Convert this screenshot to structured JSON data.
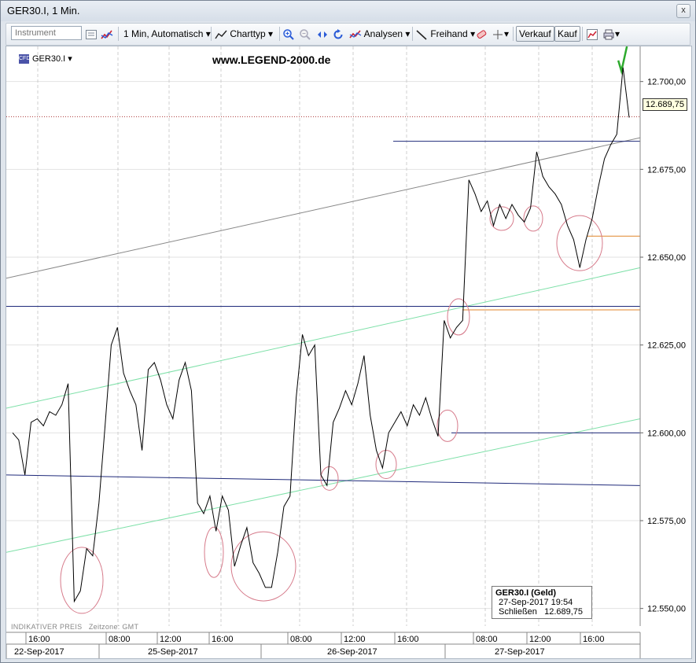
{
  "window": {
    "title": "GER30.I, 1 Min.",
    "close_label": "x"
  },
  "toolbar": {
    "instrument_placeholder": "Instrument",
    "interval_label": "1 Min,  Automatisch",
    "charttyp_label": "Charttyp",
    "analysen_label": "Analysen",
    "freihand_label": "Freihand",
    "verkauf_label": "Verkauf",
    "kauf_label": "Kauf"
  },
  "chart": {
    "symbol": "GER30.I",
    "watermark": "www.LEGEND-2000.de",
    "last_price_tag": "12.689,75",
    "footer_left": "INDIKATIVER PREIS",
    "timezone": "Zeitzone: GMT",
    "info": {
      "title": "GER30.I (Geld)",
      "datetime": "27-Sep-2017 19:54",
      "close_label": "Schließen",
      "close_value": "12.689,75"
    },
    "colors": {
      "price_line": "#000000",
      "channel": "#7ee0a8",
      "level": "#1f2a7a",
      "trend": "#888888",
      "orange": "#e0852a",
      "circle": "#d67a8a"
    }
  },
  "chart_data": {
    "type": "line",
    "ylim": [
      12545,
      12710
    ],
    "y_ticks": [
      "12.700,00",
      "12.675,00",
      "12.650,00",
      "12.625,00",
      "12.600,00",
      "12.575,00",
      "12.550,00"
    ],
    "time_ticks": [
      "16:00",
      "08:00",
      "12:00",
      "16:00",
      "08:00",
      "12:00",
      "16:00",
      "08:00",
      "12:00",
      "16:00"
    ],
    "dates": [
      "22-Sep-2017",
      "25-Sep-2017",
      "26-Sep-2017",
      "27-Sep-2017"
    ],
    "series": [
      {
        "values": [
          12600,
          12598,
          12588,
          12603,
          12604,
          12602,
          12606,
          12605,
          12608,
          12614,
          12552,
          12555,
          12567,
          12565,
          12580,
          12602,
          12625,
          12630,
          12617,
          12612,
          12608,
          12595,
          12618,
          12620,
          12615,
          12608,
          12604,
          12615,
          12620,
          12612,
          12580,
          12577,
          12582,
          12572,
          12582,
          12578,
          12562,
          12568,
          12573,
          12563,
          12560,
          12556,
          12556,
          12566,
          12579,
          12582,
          12610,
          12628,
          12622,
          12625,
          12588,
          12585,
          12603,
          12607,
          12612,
          12608,
          12614,
          12622,
          12605,
          12595,
          12590,
          12600,
          12603,
          12606,
          12602,
          12608,
          12605,
          12610,
          12604,
          12599,
          12632,
          12627,
          12630,
          12632,
          12672,
          12668,
          12663,
          12666,
          12659,
          12665,
          12661,
          12665,
          12662,
          12660,
          12664,
          12680,
          12673,
          12670,
          12668,
          12665,
          12659,
          12655,
          12647,
          12655,
          12661,
          12670,
          12678,
          12682,
          12685,
          12704,
          12689.75
        ]
      }
    ]
  }
}
